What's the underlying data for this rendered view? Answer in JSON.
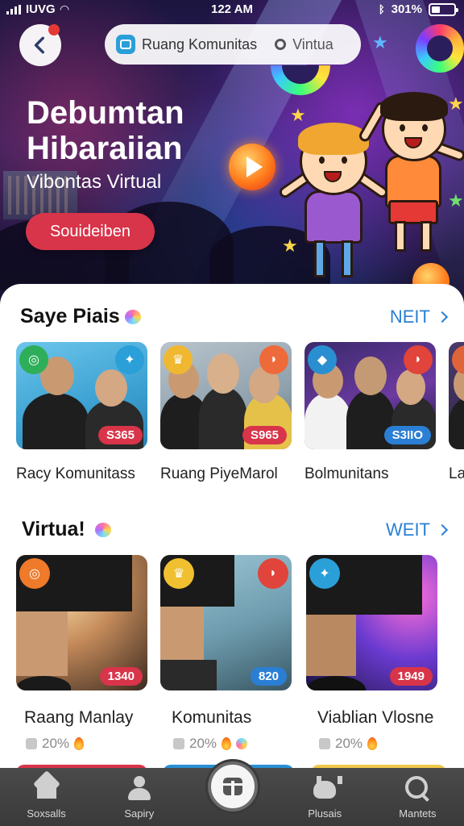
{
  "status_bar": {
    "carrier": "IUVG",
    "time": "122 AM",
    "battery": "301%"
  },
  "search_bar": {
    "primary": "Ruang Komunitas",
    "secondary": "Vintua"
  },
  "hero": {
    "title_line1": "Debumtan",
    "title_line2": "Hibaraiian",
    "subtitle": "Vibontas Virtual",
    "cta_label": "Souideiben"
  },
  "section1": {
    "title": "Saye Piais",
    "see_all": "NEIT",
    "cards": [
      {
        "name": "Racy Komunitass",
        "price": "S365",
        "price_color": "#d8344a"
      },
      {
        "name": "Ruang PiyeMarol",
        "price": "S965",
        "price_color": "#d8344a"
      },
      {
        "name": "Bolmunitans",
        "price": "S3IIO",
        "price_color": "#2a7fd4"
      },
      {
        "name": "Lat"
      }
    ]
  },
  "section2": {
    "title": "Virtua!",
    "see_all": "WEIT",
    "cards": [
      {
        "name": "Raang Manlay",
        "price": "1340",
        "price_color": "#d8344a",
        "stat": "20%"
      },
      {
        "name": "Komunitas",
        "price": "820",
        "price_color": "#2a7fd4",
        "stat": "20%"
      },
      {
        "name": "Viablian Vlosne",
        "price": "1949",
        "price_color": "#d8344a",
        "stat": "20%"
      }
    ]
  },
  "tabbar": {
    "tabs": [
      {
        "label": "Soxsalls"
      },
      {
        "label": "Sapiry"
      },
      {
        "label": ""
      },
      {
        "label": "Plusais"
      },
      {
        "label": "Mantets"
      }
    ]
  },
  "colors": {
    "accent_blue": "#2a7fd4",
    "accent_red": "#d8344a",
    "tab_bg": "#3a3a3a"
  }
}
